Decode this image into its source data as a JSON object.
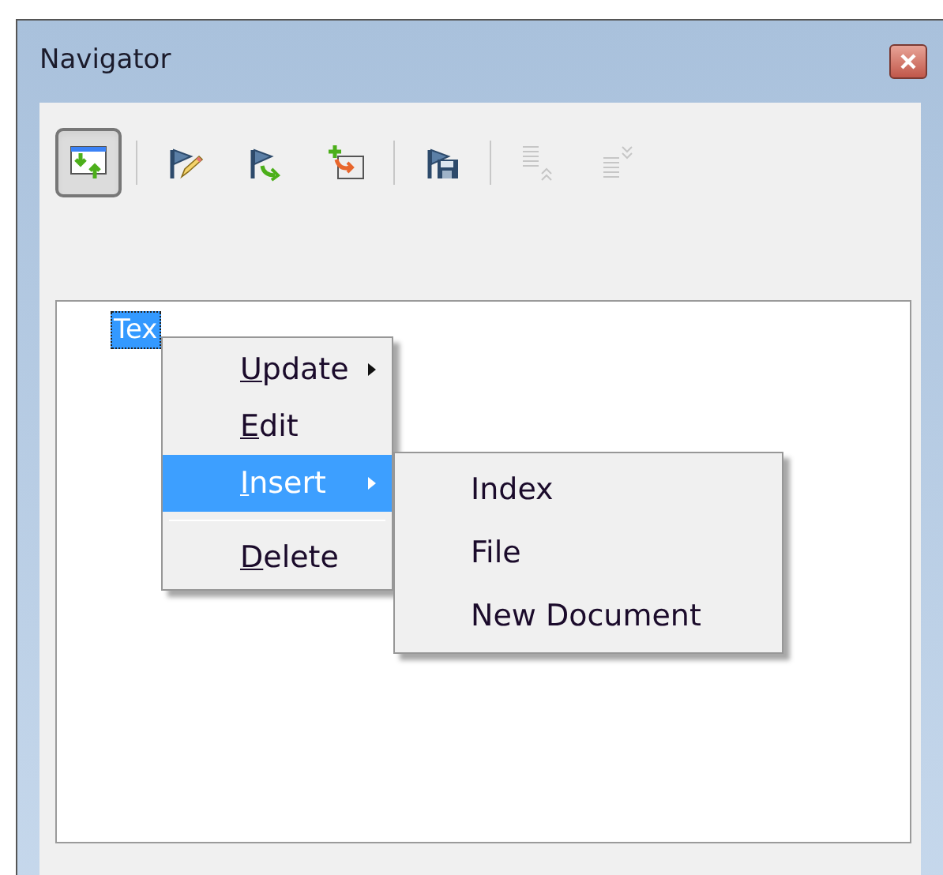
{
  "window": {
    "title": "Navigator"
  },
  "toolbar": [
    {
      "kind": "drag",
      "selected": true,
      "disabled": false,
      "separator_before": false
    },
    {
      "kind": "edit",
      "selected": false,
      "disabled": false,
      "separator_before": true
    },
    {
      "kind": "update",
      "selected": false,
      "disabled": false,
      "separator_before": false
    },
    {
      "kind": "insert",
      "selected": false,
      "disabled": false,
      "separator_before": false
    },
    {
      "kind": "save",
      "selected": false,
      "disabled": false,
      "separator_before": true
    },
    {
      "kind": "up",
      "selected": false,
      "disabled": true,
      "separator_before": true
    },
    {
      "kind": "down",
      "selected": false,
      "disabled": true,
      "separator_before": false
    }
  ],
  "tree": {
    "items": [
      {
        "label": "Tex",
        "selected": true
      }
    ]
  },
  "context_menu": {
    "items": [
      {
        "kind": "item",
        "label": "Update",
        "submenu": true,
        "selected": false
      },
      {
        "kind": "item",
        "label": "Edit",
        "submenu": false,
        "selected": false
      },
      {
        "kind": "item",
        "label": "Insert",
        "submenu": true,
        "selected": true
      },
      {
        "kind": "separator"
      },
      {
        "kind": "item",
        "label": "Delete",
        "submenu": false,
        "selected": false
      }
    ]
  },
  "submenu": {
    "items": [
      {
        "label": "Index"
      },
      {
        "label": "File"
      },
      {
        "label": "New Document"
      }
    ]
  }
}
